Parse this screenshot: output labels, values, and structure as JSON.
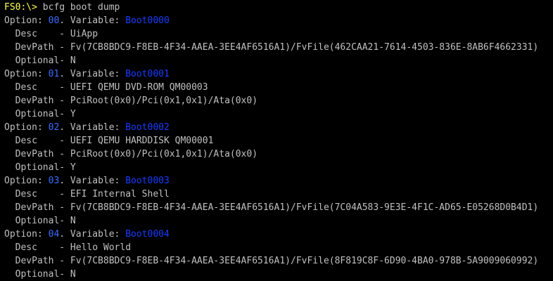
{
  "terminal": {
    "prompt": "FS0:\\>",
    "command": " bcfg boot dump"
  },
  "options": [
    {
      "number": "00",
      "variable": "Boot0000",
      "desc": "UiApp",
      "devpath": "Fv(7CB8BDC9-F8EB-4F34-AAEA-3EE4AF6516A1)/FvFile(462CAA21-7614-4503-836E-8AB6F4662331)",
      "optional": "N"
    },
    {
      "number": "01",
      "variable": "Boot0001",
      "desc": "UEFI QEMU DVD-ROM QM00003",
      "devpath": "PciRoot(0x0)/Pci(0x1,0x1)/Ata(0x0)",
      "optional": "Y"
    },
    {
      "number": "02",
      "variable": "Boot0002",
      "desc": "UEFI QEMU HARDDISK QM00001",
      "devpath": "PciRoot(0x0)/Pci(0x1,0x1)/Ata(0x0)",
      "optional": "Y"
    },
    {
      "number": "03",
      "variable": "Boot0003",
      "desc": "EFI Internal Shell",
      "devpath": "Fv(7CB8BDC9-F8EB-4F34-AAEA-3EE4AF6516A1)/FvFile(7C04A583-9E3E-4F1C-AD65-E05268D0B4D1)",
      "optional": "N"
    },
    {
      "number": "04",
      "variable": "Boot0004",
      "desc": "Hello World",
      "devpath": "Fv(7CB8BDC9-F8EB-4F34-AAEA-3EE4AF6516A1)/FvFile(8F819C8F-6D90-4BA0-978B-5A9009060992)",
      "optional": "N"
    }
  ],
  "labels": {
    "option": "Option: ",
    "dot_variable": ". Variable: ",
    "desc": "  Desc    - ",
    "devpath": "  DevPath - ",
    "optional": "  Optional- "
  },
  "colors": {
    "background": "#000000",
    "text": "#c0c0c0",
    "prompt": "#ffff55",
    "option_number": "#3c6cff",
    "variable_name": "#1a3cff"
  }
}
